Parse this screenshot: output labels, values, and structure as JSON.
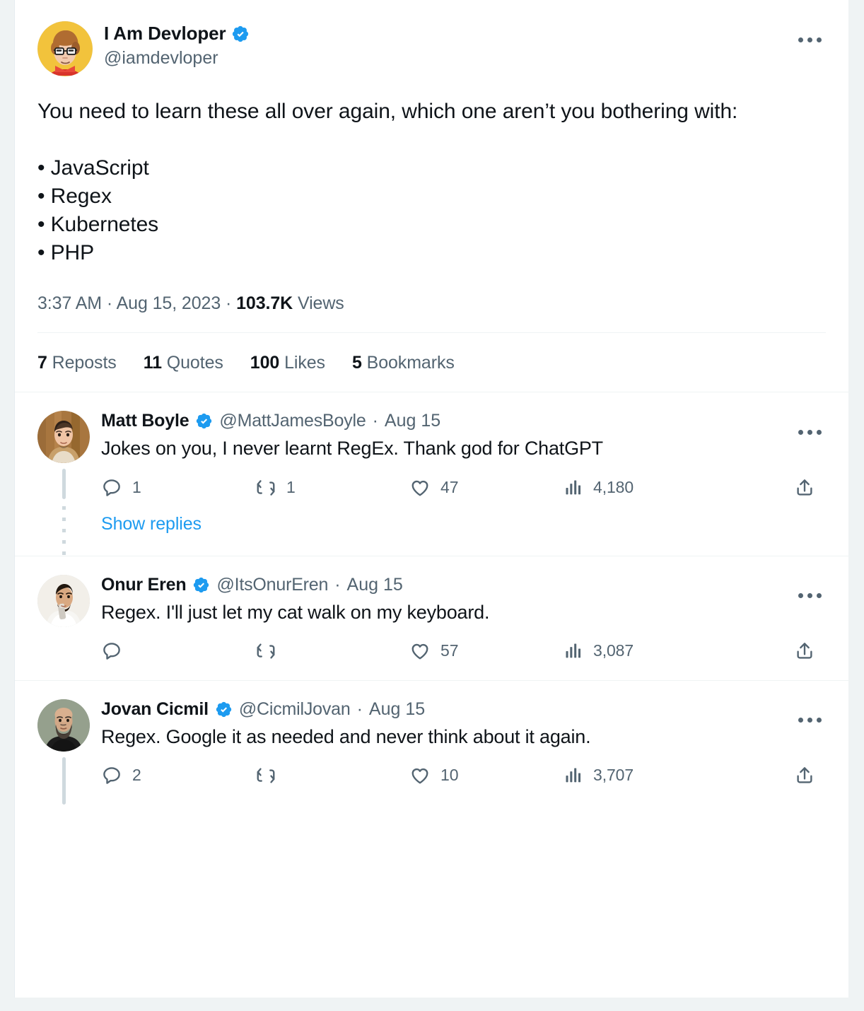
{
  "main_tweet": {
    "display_name": "I Am Devloper",
    "verified": true,
    "handle": "@iamdevloper",
    "avatar_alt": "cartoon-developer-avatar",
    "text_lines": [
      "You need to learn these all over again, which one aren’t you bothering with:",
      "",
      "• JavaScript",
      "• Regex",
      "• Kubernetes",
      "• PHP"
    ],
    "timestamp": {
      "time": "3:37 AM",
      "sep1": "·",
      "date": "Aug 15, 2023",
      "sep2": "·",
      "views_count": "103.7K",
      "views_label": "Views"
    },
    "stats": [
      {
        "count": "7",
        "label": "Reposts"
      },
      {
        "count": "11",
        "label": "Quotes"
      },
      {
        "count": "100",
        "label": "Likes"
      },
      {
        "count": "5",
        "label": "Bookmarks"
      }
    ]
  },
  "replies": [
    {
      "display_name": "Matt Boyle",
      "verified": true,
      "handle": "@MattJamesBoyle",
      "separator": "·",
      "date": "Aug 15",
      "text": "Jokes on you, I never learnt RegEx. Thank god for ChatGPT",
      "avatar_alt": "matt-boyle-photo-avatar",
      "actions": {
        "reply_count": "1",
        "repost_count": "1",
        "like_count": "47",
        "views_count": "4,180"
      },
      "show_replies_label": "Show replies",
      "has_show_replies": true,
      "has_thread_line": true
    },
    {
      "display_name": "Onur Eren",
      "verified": true,
      "handle": "@ItsOnurEren",
      "separator": "·",
      "date": "Aug 15",
      "text": "Regex. I'll just let my cat walk on my keyboard.",
      "avatar_alt": "onur-eren-photo-avatar",
      "actions": {
        "reply_count": "",
        "repost_count": "",
        "like_count": "57",
        "views_count": "3,087"
      },
      "show_replies_label": "",
      "has_show_replies": false,
      "has_thread_line": false
    },
    {
      "display_name": "Jovan Cicmil",
      "verified": true,
      "handle": "@CicmilJovan",
      "separator": "·",
      "date": "Aug 15",
      "text": "Regex. Google it as needed and never think about it again.",
      "avatar_alt": "jovan-cicmil-photo-avatar",
      "actions": {
        "reply_count": "2",
        "repost_count": "",
        "like_count": "10",
        "views_count": "3,707"
      },
      "show_replies_label": "",
      "has_show_replies": false,
      "has_thread_line": true
    }
  ],
  "icons": {
    "more": "more-horizontal-icon",
    "verified": "verified-badge-icon",
    "reply": "reply-icon",
    "repost": "repost-icon",
    "like": "heart-icon",
    "views": "analytics-bar-icon",
    "share": "share-icon"
  },
  "colors": {
    "accent_blue": "#1d9bf0",
    "text_primary": "#0f1419",
    "text_secondary": "#536471",
    "divider": "#eff3f4",
    "page_background": "#eff3f4",
    "card_background": "#ffffff",
    "thread_line": "#cfd9de"
  }
}
